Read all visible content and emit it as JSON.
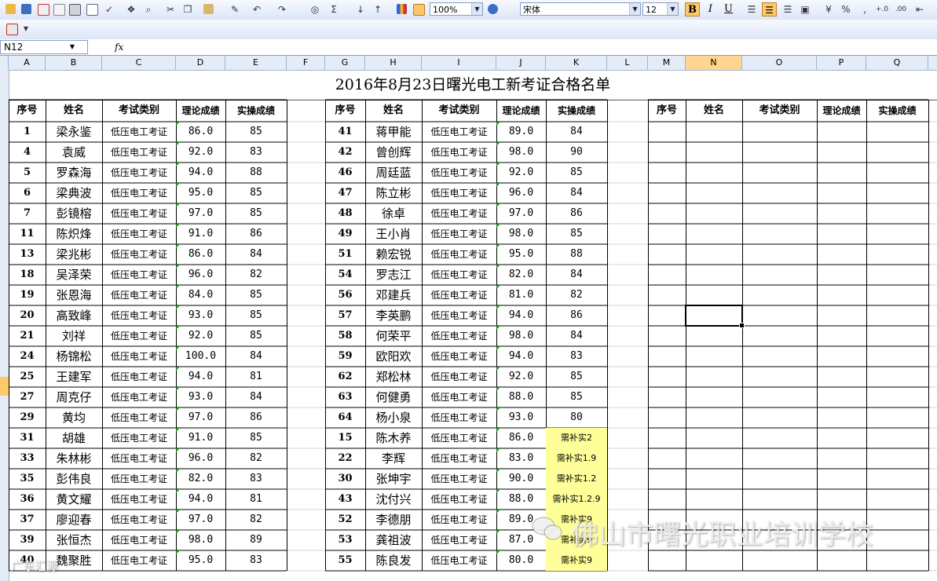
{
  "toolbar": {
    "zoom": "100%",
    "font_name": "宋体",
    "font_size": "12",
    "bold_label": "B",
    "italic_label": "I",
    "underline_label": "U",
    "sum_label": "Σ",
    "percent_label": "%",
    "comma_label": ","
  },
  "formula_bar": {
    "name_box": "N12",
    "fx_label": "fx",
    "content": ""
  },
  "columns": [
    "A",
    "B",
    "C",
    "D",
    "E",
    "F",
    "G",
    "H",
    "I",
    "J",
    "K",
    "L",
    "M",
    "N",
    "O",
    "P",
    "Q"
  ],
  "selected_column": "N",
  "sheet": {
    "title": "2016年8月23日曙光电工新考证合格名单",
    "headers": [
      "序号",
      "姓名",
      "考试类别",
      "理论成绩",
      "实操成绩"
    ],
    "left_rows": [
      [
        "1",
        "梁永鉴",
        "低压电工考证",
        "86.0",
        "85"
      ],
      [
        "4",
        "袁威",
        "低压电工考证",
        "92.0",
        "83"
      ],
      [
        "5",
        "罗森海",
        "低压电工考证",
        "94.0",
        "88"
      ],
      [
        "6",
        "梁典波",
        "低压电工考证",
        "95.0",
        "85"
      ],
      [
        "7",
        "彭镜榕",
        "低压电工考证",
        "97.0",
        "85"
      ],
      [
        "11",
        "陈炽烽",
        "低压电工考证",
        "91.0",
        "86"
      ],
      [
        "13",
        "梁兆彬",
        "低压电工考证",
        "86.0",
        "84"
      ],
      [
        "18",
        "吴泽荣",
        "低压电工考证",
        "96.0",
        "82"
      ],
      [
        "19",
        "张恩海",
        "低压电工考证",
        "84.0",
        "85"
      ],
      [
        "20",
        "高致峰",
        "低压电工考证",
        "93.0",
        "85"
      ],
      [
        "21",
        "刘祥",
        "低压电工考证",
        "92.0",
        "85"
      ],
      [
        "24",
        "杨锦松",
        "低压电工考证",
        "100.0",
        "84"
      ],
      [
        "25",
        "王建军",
        "低压电工考证",
        "94.0",
        "81"
      ],
      [
        "27",
        "周克仔",
        "低压电工考证",
        "93.0",
        "84"
      ],
      [
        "29",
        "黄均",
        "低压电工考证",
        "97.0",
        "86"
      ],
      [
        "31",
        "胡雄",
        "低压电工考证",
        "91.0",
        "85"
      ],
      [
        "33",
        "朱林彬",
        "低压电工考证",
        "96.0",
        "82"
      ],
      [
        "35",
        "彭伟良",
        "低压电工考证",
        "82.0",
        "83"
      ],
      [
        "36",
        "黄文耀",
        "低压电工考证",
        "94.0",
        "81"
      ],
      [
        "37",
        "廖迎春",
        "低压电工考证",
        "97.0",
        "82"
      ],
      [
        "39",
        "张恒杰",
        "低压电工考证",
        "98.0",
        "89"
      ],
      [
        "40",
        "魏聚胜",
        "低压电工考证",
        "95.0",
        "83"
      ]
    ],
    "right_rows": [
      [
        "41",
        "蒋甲能",
        "低压电工考证",
        "89.0",
        "84"
      ],
      [
        "42",
        "曾创辉",
        "低压电工考证",
        "98.0",
        "90"
      ],
      [
        "46",
        "周廷蓝",
        "低压电工考证",
        "92.0",
        "85"
      ],
      [
        "47",
        "陈立彬",
        "低压电工考证",
        "96.0",
        "84"
      ],
      [
        "48",
        "徐卓",
        "低压电工考证",
        "97.0",
        "86"
      ],
      [
        "49",
        "王小肖",
        "低压电工考证",
        "98.0",
        "85"
      ],
      [
        "51",
        "赖宏锐",
        "低压电工考证",
        "95.0",
        "88"
      ],
      [
        "54",
        "罗志江",
        "低压电工考证",
        "82.0",
        "84"
      ],
      [
        "56",
        "邓建兵",
        "低压电工考证",
        "81.0",
        "82"
      ],
      [
        "57",
        "李英鹏",
        "低压电工考证",
        "94.0",
        "86"
      ],
      [
        "58",
        "何荣平",
        "低压电工考证",
        "98.0",
        "84"
      ],
      [
        "59",
        "欧阳欢",
        "低压电工考证",
        "94.0",
        "83"
      ],
      [
        "62",
        "郑松林",
        "低压电工考证",
        "92.0",
        "85"
      ],
      [
        "63",
        "何健勇",
        "低压电工考证",
        "88.0",
        "85"
      ],
      [
        "64",
        "杨小泉",
        "低压电工考证",
        "93.0",
        "80"
      ],
      [
        "15",
        "陈木养",
        "低压电工考证",
        "86.0",
        "需补实2"
      ],
      [
        "22",
        "李辉",
        "低压电工考证",
        "83.0",
        "需补实1.9"
      ],
      [
        "30",
        "张坤宇",
        "低压电工考证",
        "90.0",
        "需补实1.2"
      ],
      [
        "43",
        "沈付兴",
        "低压电工考证",
        "88.0",
        "需补实1.2.9"
      ],
      [
        "52",
        "李德朋",
        "低压电工考证",
        "89.0",
        "需补实9"
      ],
      [
        "53",
        "龚祖波",
        "低压电工考证",
        "87.0",
        "需补实9"
      ],
      [
        "55",
        "陈良发",
        "低压电工考证",
        "80.0",
        "需补实9"
      ]
    ]
  },
  "watermark": {
    "text": "佛山市曙光职业培训学校",
    "small_text": "广东汇源"
  },
  "colors": {
    "toolbar_bg": "#dce6f6",
    "header_bg": "#e4ecf7",
    "selected_header": "#ffd58f",
    "yellow_fill": "#ffff99",
    "comment_marker": "#1e8a1e"
  }
}
